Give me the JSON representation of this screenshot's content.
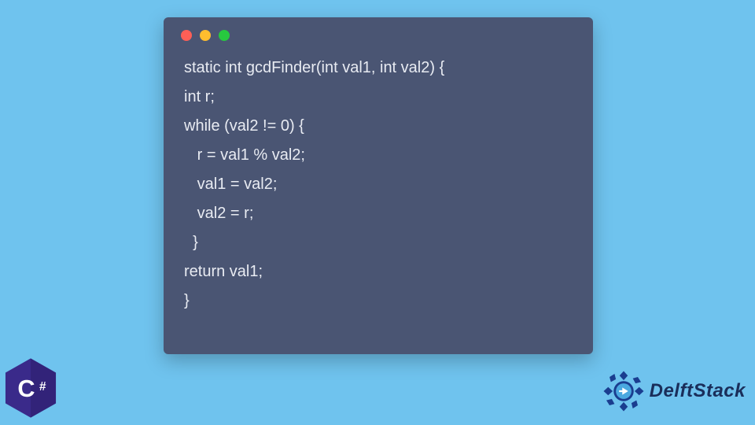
{
  "code": {
    "lines": [
      "static int gcdFinder(int val1, int val2) {",
      "int r;",
      "while (val2 != 0) {",
      "   r = val1 % val2;",
      "   val1 = val2;",
      "   val2 = r;",
      "  }",
      "return val1;",
      "}"
    ]
  },
  "csharp": {
    "label": "C#"
  },
  "brand": {
    "name": "DelftStack"
  },
  "colors": {
    "page_bg": "#6fc3ee",
    "window_bg": "#4a5573",
    "code_text": "#e8ebf2",
    "dot_red": "#ff5f56",
    "dot_yellow": "#ffbd2e",
    "dot_green": "#27c93f",
    "csharp_purple": "#3a2a8a",
    "delft_blue": "#1a3d8f"
  }
}
